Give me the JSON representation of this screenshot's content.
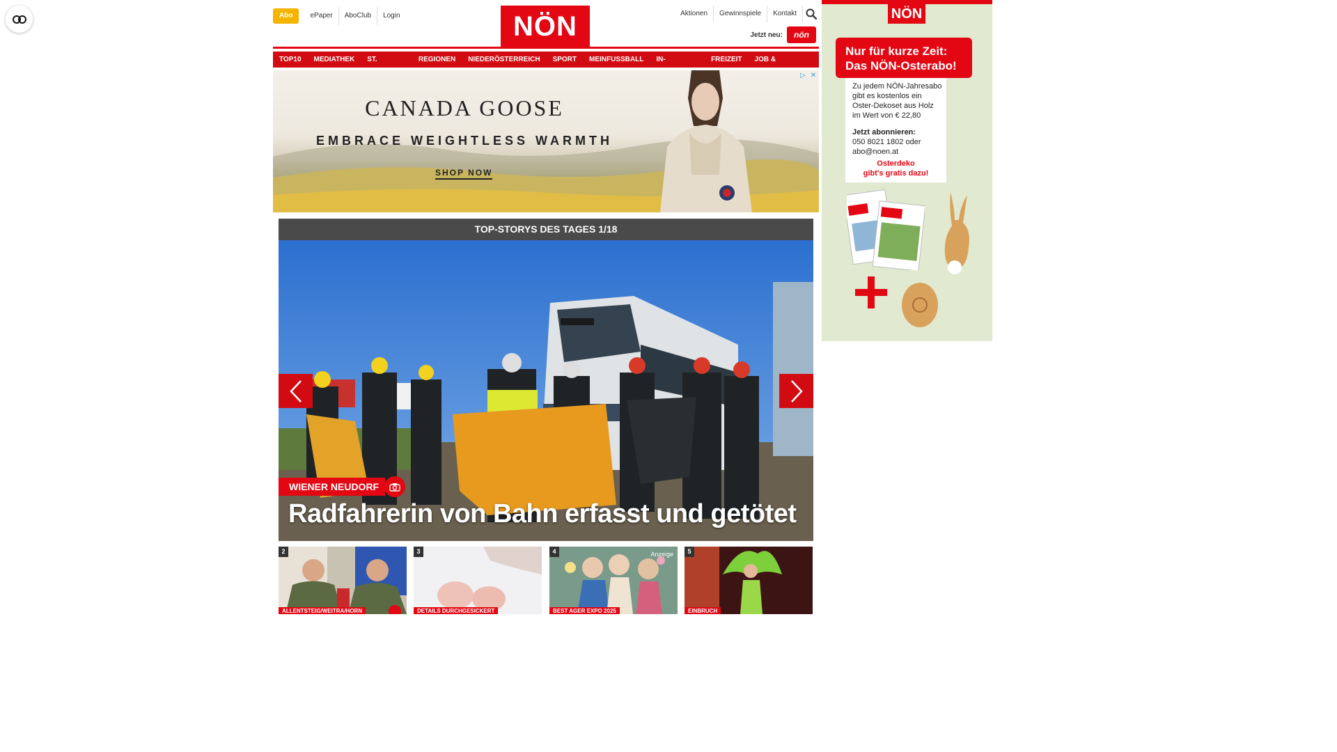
{
  "header": {
    "abo_label": "Abo",
    "top_links": [
      "ePaper",
      "AboClub",
      "Login"
    ],
    "logo_text": "NÖN",
    "right_links": [
      "Aktionen",
      "Gewinnspiele",
      "Kontakt"
    ],
    "jetzt_neu_label": "Jetzt neu:",
    "mini_logo_text": "nön"
  },
  "nav": {
    "items": [
      "TOP10",
      "MEDIATHEK",
      "ST. PÖLTEN",
      "REGIONEN",
      "NIEDERÖSTERREICH",
      "SPORT",
      "MEINFUSSBALL",
      "IN-AUSLAND",
      "FREIZEIT",
      "JOB & KARRIERE"
    ]
  },
  "ad_banner": {
    "brand": "CANADA GOOSE",
    "tagline": "EMBRACE WEIGHTLESS WARMTH",
    "cta": "SHOP NOW"
  },
  "top_stories": {
    "heading": "TOP-STORYS DES TAGES 1/18",
    "hero": {
      "tag": "WIENER NEUDORF",
      "title": "Radfahrerin von Bahn erfasst und getötet"
    },
    "thumbs": [
      {
        "num": "2",
        "tag": "ALLENTSTEIG/WEITRA/HORN",
        "ad": ""
      },
      {
        "num": "3",
        "tag": "DETAILS DURCHGESICKERT",
        "ad": ""
      },
      {
        "num": "4",
        "tag": "BEST AGER EXPO 2025",
        "ad": "Anzeige"
      },
      {
        "num": "5",
        "tag": "EINBRUCH",
        "ad": ""
      }
    ]
  },
  "side_ad": {
    "logo": "NÖN",
    "headline_1": "Nur für kurze Zeit:",
    "headline_2": "Das NÖN-Osterabo!",
    "body": "Zu jedem NÖN-Jahresabo gibt es kostenlos ein Oster-Dekoset aus Holz im Wert von € 22,80",
    "cta_label": "Jetzt abonnieren:",
    "phone": "050 8021 1802 oder",
    "email": "abo@noen.at",
    "red_1": "Osterdeko",
    "red_2": "gibt's gratis dazu!"
  },
  "colors": {
    "brand_red": "#e30613",
    "nav_red": "#d20a11",
    "abo_yellow": "#f5b400",
    "stories_bar": "#4a4a4a"
  },
  "icons": [
    "reader-mode-icon",
    "search-icon",
    "camera-icon",
    "chevron-left-icon",
    "chevron-right-icon",
    "ad-choices-icon",
    "close-icon"
  ]
}
